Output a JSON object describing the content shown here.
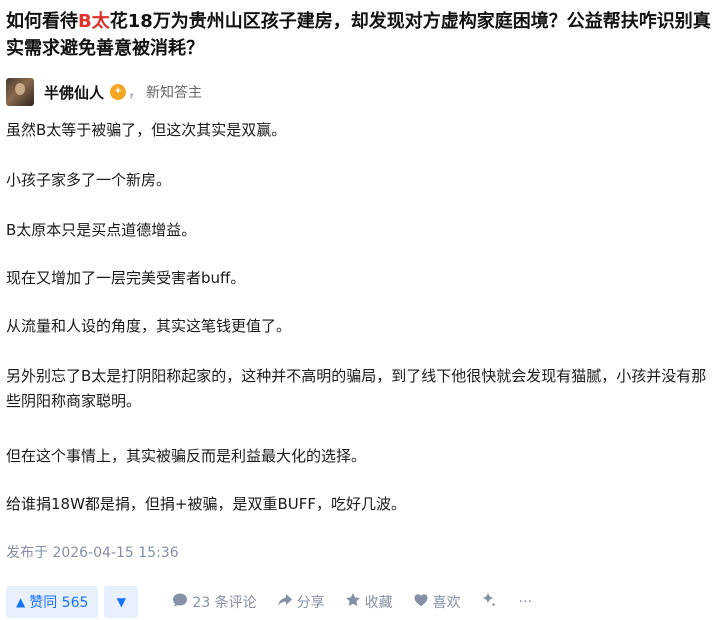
{
  "question": {
    "title_prefix": "如何看待",
    "title_highlight": "B太",
    "title_suffix": "花18万为贵州山区孩子建房，却发现对方虚构家庭困境？公益帮扶咋识别真实需求避免善意被消耗？"
  },
  "author": {
    "name": "半佛仙人",
    "separator": "，",
    "description": "新知答主"
  },
  "answer": {
    "paragraphs": [
      "虽然B太等于被骗了，但这次其实是双赢。",
      "小孩子家多了一个新房。",
      "B太原本只是买点道德增益。",
      "现在又增加了一层完美受害者buff。",
      "从流量和人设的角度，其实这笔钱更值了。",
      "另外别忘了B太是打阴阳称起家的，这种并不高明的骗局，到了线下他很快就会发现有猫腻，小孩并没有那些阴阳称商家聪明。",
      "但在这个事情上，其实被骗反而是利益最大化的选择。",
      "给谁捐18W都是捐，但捐+被骗，是双重BUFF，吃好几波。"
    ],
    "published": "发布于 2026-04-15 15:36"
  },
  "actions": {
    "upvote_label": "赞同 565",
    "upvote_icon": "▲",
    "downvote_icon": "▼",
    "comment_label": "23 条评论",
    "share_label": "分享",
    "favorite_label": "收藏",
    "like_label": "喜欢",
    "more_dots": "···"
  },
  "colors": {
    "highlight": "#e0322b",
    "accent": "#1772f6",
    "muted": "#8590a6"
  }
}
